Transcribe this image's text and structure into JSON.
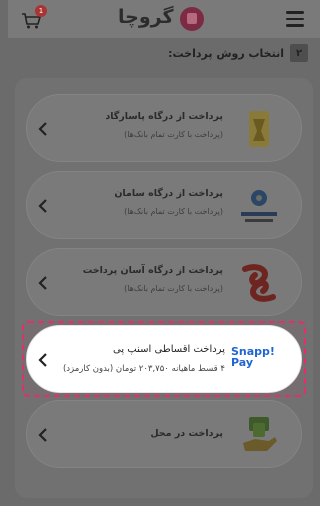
{
  "header": {
    "logo_text": "گروچا",
    "cart_count": "1"
  },
  "section": {
    "step_number": "۲",
    "title": "انتخاب روش پرداخت:"
  },
  "methods": [
    {
      "title": "پرداخت از درگاه پاسارگاد",
      "subtitle": "(پرداخت با کارت تمام بانک‌ها)"
    },
    {
      "title": "پرداخت از درگاه سامان",
      "subtitle": "(پرداخت با کارت تمام بانک‌ها)"
    },
    {
      "title": "پرداخت از درگاه آسان پرداخت",
      "subtitle": "(پرداخت با کارت تمام بانک‌ها)"
    },
    {
      "title": "پرداخت اقساطی اسنپ پی",
      "subtitle": "۴ قسط ماهیانه ۲۰۳,۷۵۰ تومان (بدون کارمزد)",
      "logo_line1": "Snapp!",
      "logo_line2": "Pay"
    },
    {
      "title": "پرداخت در محل"
    }
  ],
  "colors": {
    "highlight": "#e0306e",
    "snapp_blue": "#1f66d1",
    "brand": "#7d2a44"
  }
}
